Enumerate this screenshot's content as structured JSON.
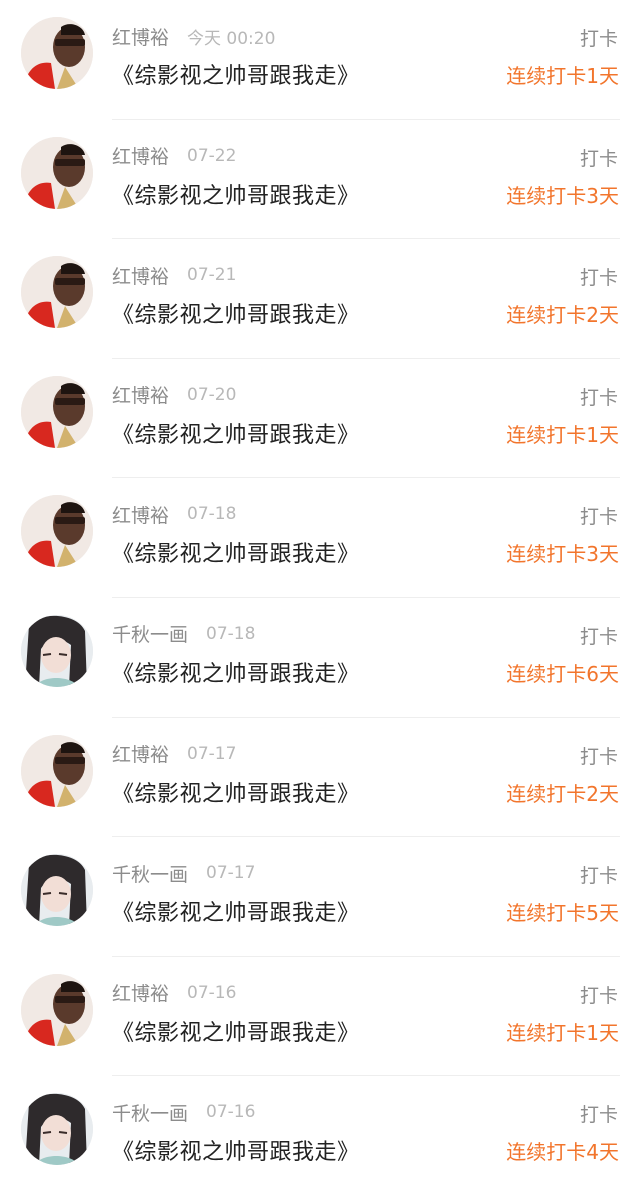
{
  "colors": {
    "accent": "#f2752c",
    "muted": "#8c8c8c",
    "title": "#222222"
  },
  "feed": {
    "items": [
      {
        "avatar_icon": "user-avatar-red",
        "username": "红博裕",
        "time": "今天 00:20",
        "title": "《综影视之帅哥跟我走》",
        "tag": "打卡",
        "streak": "连续打卡1天"
      },
      {
        "avatar_icon": "user-avatar-red",
        "username": "红博裕",
        "time": "07-22",
        "title": "《综影视之帅哥跟我走》",
        "tag": "打卡",
        "streak": "连续打卡3天"
      },
      {
        "avatar_icon": "user-avatar-red",
        "username": "红博裕",
        "time": "07-21",
        "title": "《综影视之帅哥跟我走》",
        "tag": "打卡",
        "streak": "连续打卡2天"
      },
      {
        "avatar_icon": "user-avatar-red",
        "username": "红博裕",
        "time": "07-20",
        "title": "《综影视之帅哥跟我走》",
        "tag": "打卡",
        "streak": "连续打卡1天"
      },
      {
        "avatar_icon": "user-avatar-red",
        "username": "红博裕",
        "time": "07-18",
        "title": "《综影视之帅哥跟我走》",
        "tag": "打卡",
        "streak": "连续打卡3天"
      },
      {
        "avatar_icon": "user-avatar-girl",
        "username": "千秋一画",
        "time": "07-18",
        "title": "《综影视之帅哥跟我走》",
        "tag": "打卡",
        "streak": "连续打卡6天"
      },
      {
        "avatar_icon": "user-avatar-red",
        "username": "红博裕",
        "time": "07-17",
        "title": "《综影视之帅哥跟我走》",
        "tag": "打卡",
        "streak": "连续打卡2天"
      },
      {
        "avatar_icon": "user-avatar-girl",
        "username": "千秋一画",
        "time": "07-17",
        "title": "《综影视之帅哥跟我走》",
        "tag": "打卡",
        "streak": "连续打卡5天"
      },
      {
        "avatar_icon": "user-avatar-red",
        "username": "红博裕",
        "time": "07-16",
        "title": "《综影视之帅哥跟我走》",
        "tag": "打卡",
        "streak": "连续打卡1天"
      },
      {
        "avatar_icon": "user-avatar-girl",
        "username": "千秋一画",
        "time": "07-16",
        "title": "《综影视之帅哥跟我走》",
        "tag": "打卡",
        "streak": "连续打卡4天"
      }
    ]
  }
}
